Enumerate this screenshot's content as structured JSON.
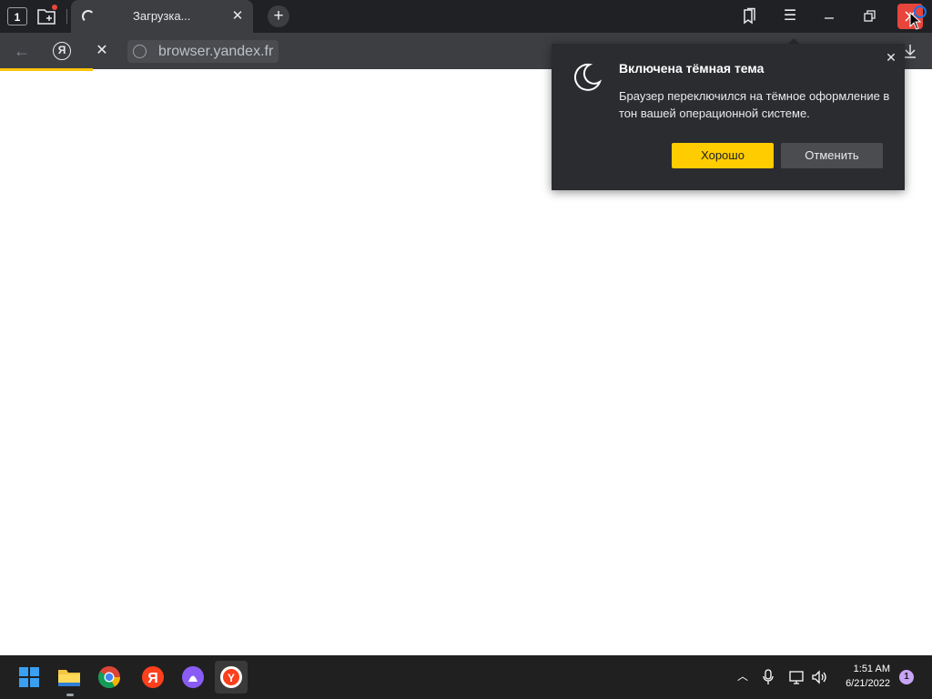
{
  "tabbar": {
    "tab_counter": "1",
    "active_tab": {
      "title": "Загрузка...",
      "close_glyph": "✕",
      "icon": "loading-spinner-icon"
    },
    "add_tab_glyph": "+",
    "icons": [
      "tabs-counter-icon",
      "new-tab-folder-icon",
      "bookmarks-icon",
      "menu-icon",
      "minimize-icon",
      "restore-icon",
      "close-icon"
    ],
    "menu_glyph": "☰"
  },
  "addressbar": {
    "back_glyph": "←",
    "yandex_glyph": "Я",
    "stop_glyph": "✕",
    "url": "browser.yandex.fr",
    "load_progress": 0.1
  },
  "popup": {
    "title": "Включена тёмная тема",
    "body": "Браузер переключился на тёмное оформление в тон вашей операционной системе.",
    "ok_label": "Хорошо",
    "cancel_label": "Отменить",
    "close_glyph": "✕",
    "icon": "moon-icon"
  },
  "taskbar": {
    "apps": [
      "start-icon",
      "file-explorer-icon",
      "chrome-icon",
      "yandex-icon",
      "alice-icon",
      "yandex-browser-icon"
    ],
    "tray": {
      "chevron_glyph": "︿",
      "time": "1:51 AM",
      "date": "6/21/2022",
      "notifications": "1"
    }
  },
  "colors": {
    "titlebar": "#202124",
    "toolbar": "#3c3e42",
    "popup_bg": "#2b2c30",
    "accent_yellow": "#ffcc00",
    "close_red": "#e8453c",
    "taskbar": "#202020"
  }
}
